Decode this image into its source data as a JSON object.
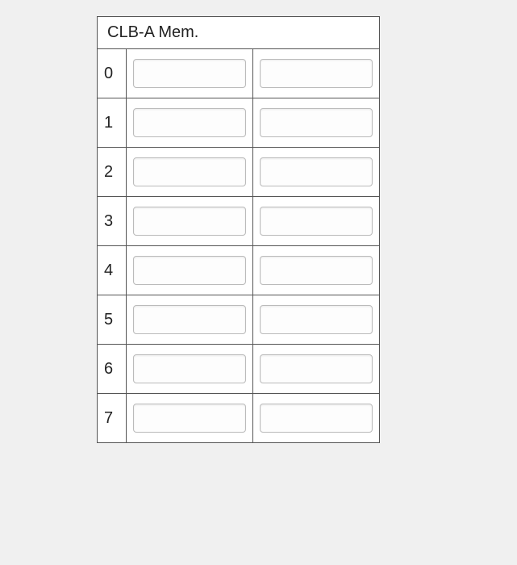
{
  "table": {
    "title": "CLB-A Mem.",
    "rows": [
      {
        "label": "0",
        "col1": "",
        "col2": ""
      },
      {
        "label": "1",
        "col1": "",
        "col2": ""
      },
      {
        "label": "2",
        "col1": "",
        "col2": ""
      },
      {
        "label": "3",
        "col1": "",
        "col2": ""
      },
      {
        "label": "4",
        "col1": "",
        "col2": ""
      },
      {
        "label": "5",
        "col1": "",
        "col2": ""
      },
      {
        "label": "6",
        "col1": "",
        "col2": ""
      },
      {
        "label": "7",
        "col1": "",
        "col2": ""
      }
    ]
  }
}
